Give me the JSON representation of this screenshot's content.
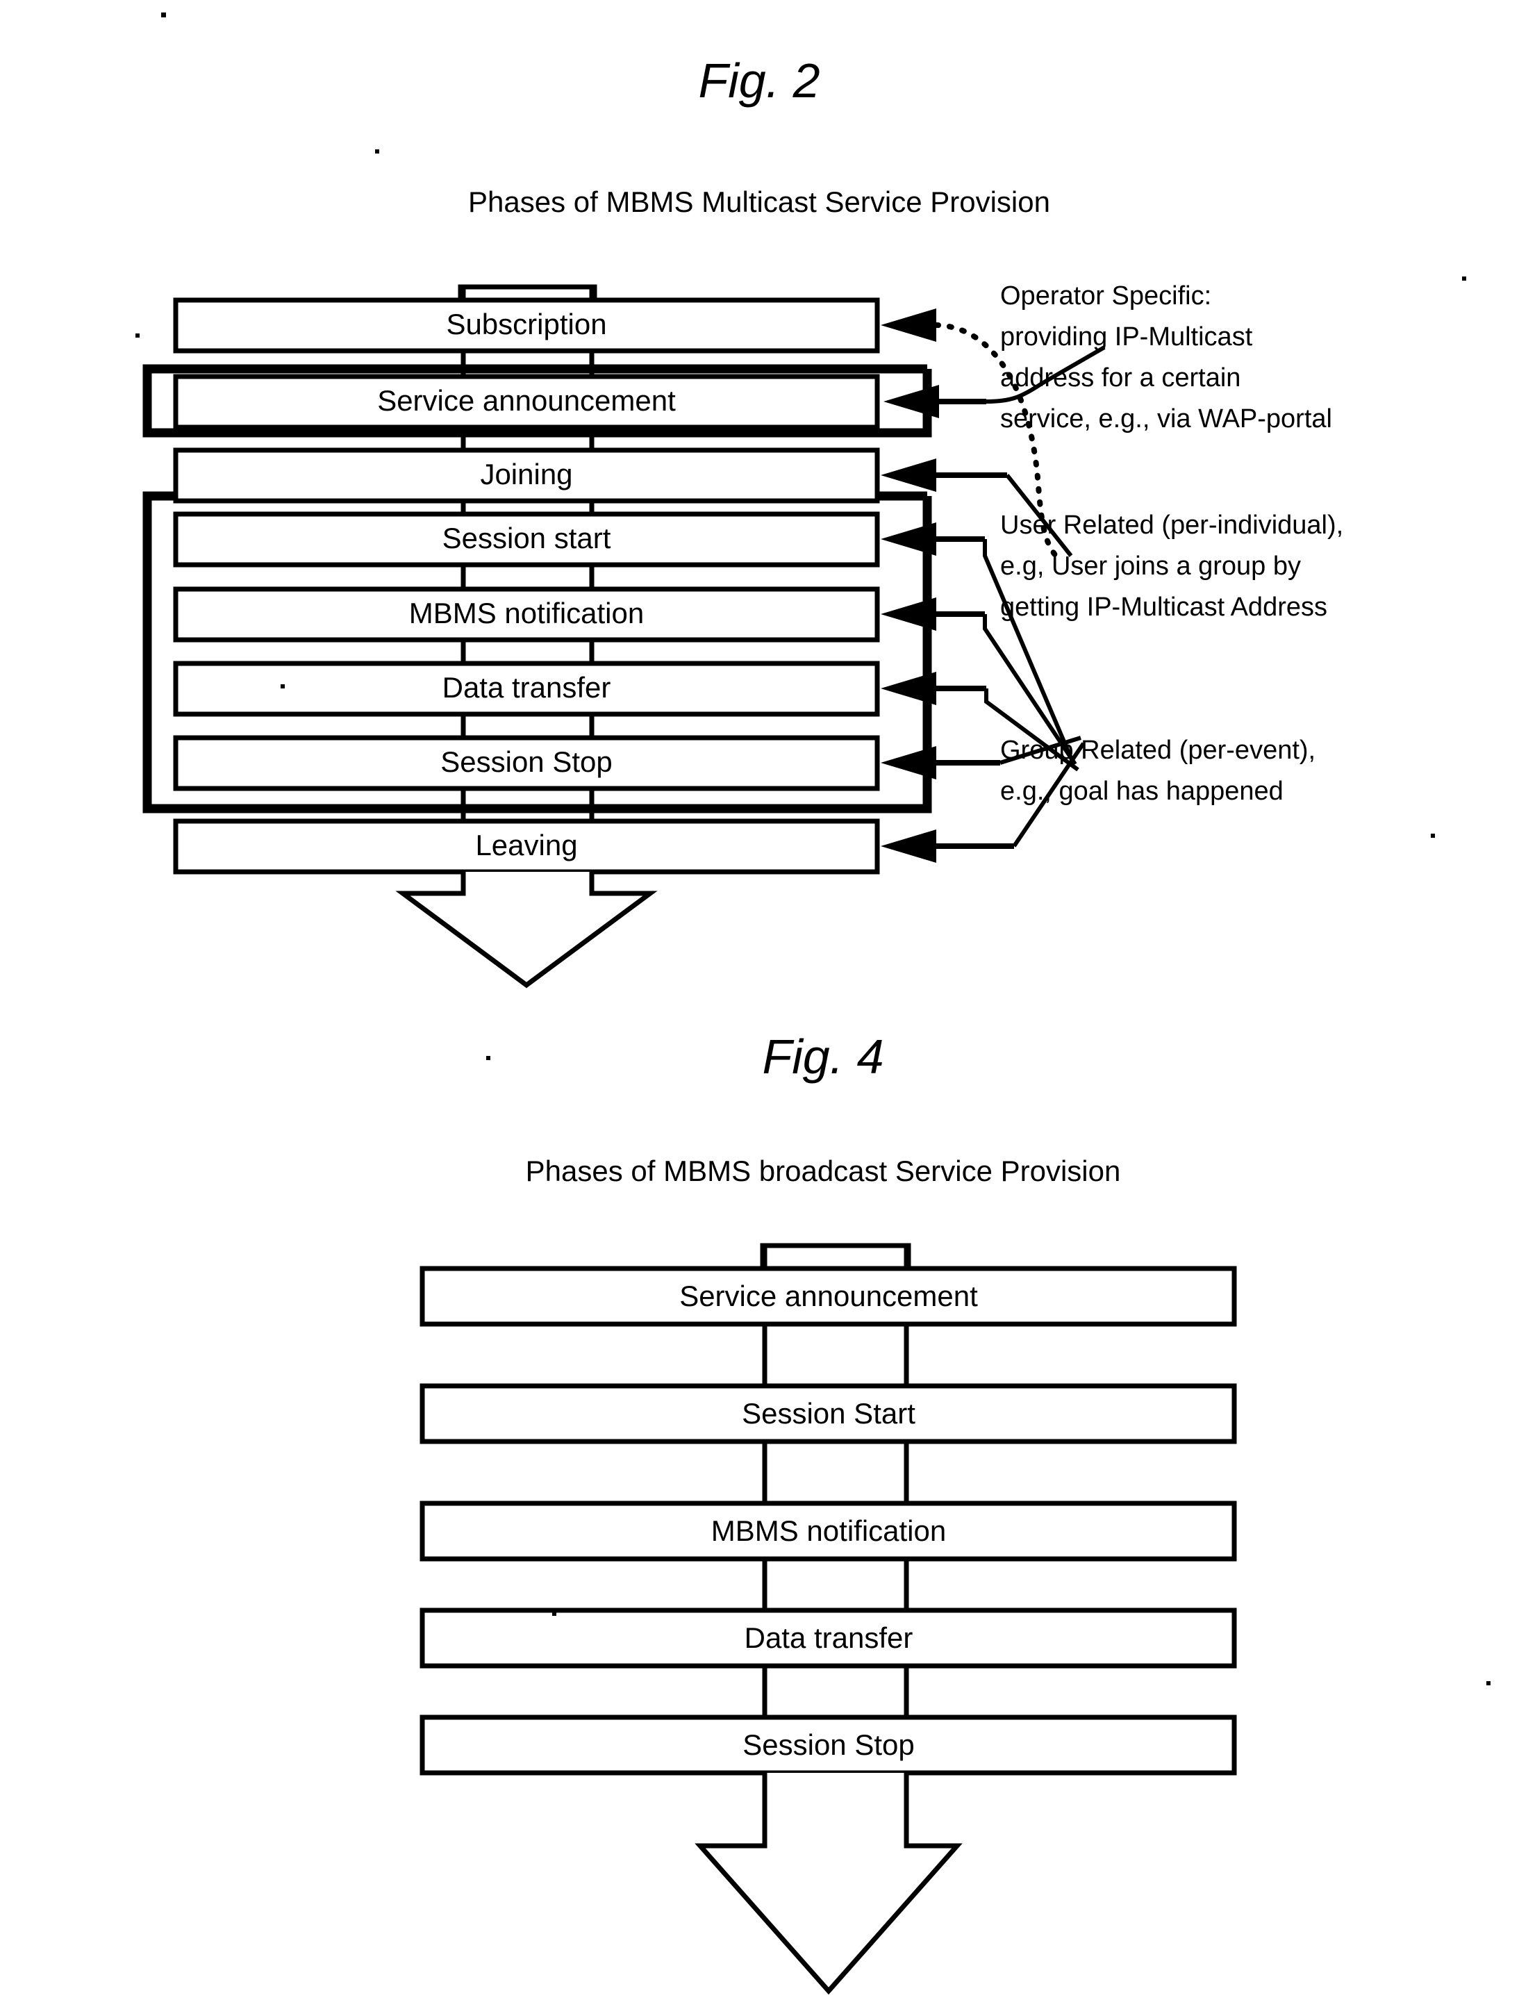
{
  "figures": [
    {
      "id": "fig2",
      "title": "Fig. 2",
      "subtitle": "Phases of MBMS Multicast Service Provision",
      "boxes": [
        {
          "label": "Subscription"
        },
        {
          "label": "Service announcement"
        },
        {
          "label": "Joining"
        },
        {
          "label": "Session start"
        },
        {
          "label": "MBMS notification"
        },
        {
          "label": "Data transfer"
        },
        {
          "label": "Session Stop"
        },
        {
          "label": "Leaving"
        }
      ],
      "annotations": [
        {
          "id": "operator-specific",
          "lines": [
            "Operator Specific:",
            "providing IP-Multicast",
            "address for a certain",
            "service, e.g., via WAP-portal"
          ]
        },
        {
          "id": "user-related",
          "lines": [
            "User Related (per-individual),",
            "e.g, User joins a group by",
            "getting IP-Multicast Address"
          ]
        },
        {
          "id": "group-related",
          "lines": [
            "Group Related (per-event),",
            "e.g., goal has happened"
          ]
        }
      ]
    },
    {
      "id": "fig4",
      "title": "Fig. 4",
      "subtitle": "Phases of MBMS broadcast Service Provision",
      "boxes": [
        {
          "label": "Service announcement"
        },
        {
          "label": "Session Start"
        },
        {
          "label": "MBMS notification"
        },
        {
          "label": "Data transfer"
        },
        {
          "label": "Session Stop"
        }
      ],
      "annotations": []
    }
  ],
  "colors": {
    "ink": "#000000",
    "paper": "#ffffff"
  }
}
